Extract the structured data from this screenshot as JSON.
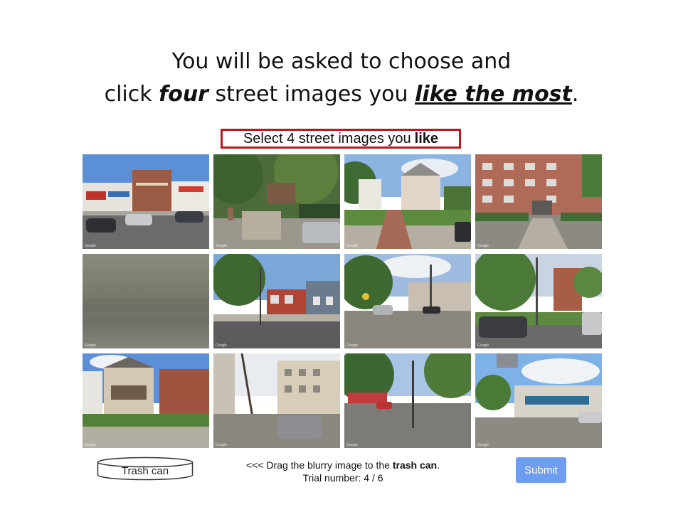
{
  "heading": {
    "line1": "You will be asked to choose and",
    "line2_pre": "click ",
    "line2_bold": "four",
    "line2_mid": " street images you ",
    "line2_underline": "like the most",
    "line2_post": "."
  },
  "prompt": {
    "text": "Select 4 street images you",
    "bold": "like"
  },
  "images": {
    "watermark": "Google"
  },
  "trash": {
    "label": "Trash can"
  },
  "instructions": {
    "pre": "<<< Drag the blurry image to the ",
    "bold": "trash can",
    "post": ".",
    "trial_label": "Trial number: ",
    "trial_value": "4 / 6"
  },
  "submit": {
    "label": "Submit"
  },
  "colors": {
    "prompt_border": "#c0141b",
    "submit_bg": "#6e9df0"
  }
}
